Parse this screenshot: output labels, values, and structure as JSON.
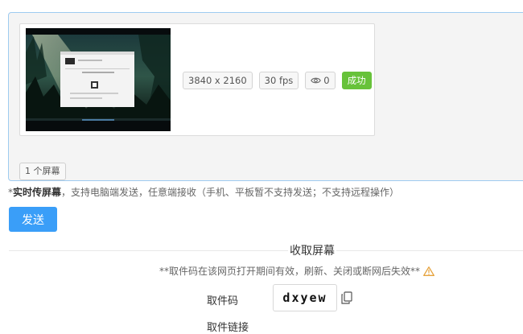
{
  "shared_screen": {
    "resolution": "3840 x 2160",
    "fps": "30 fps",
    "viewers": "0",
    "status": "成功"
  },
  "screen_count": "1 个屏幕",
  "share_note": {
    "highlight": "实时传屏幕",
    "text": "，支持电脑端发送，任意端接收（手机、平板暂不支持发送；不支持远程操作）"
  },
  "send_button": "发送",
  "receive": {
    "title": "收取屏幕",
    "note": "**取件码在该网页打开期间有效，刷新、关闭或断网后失效**",
    "code_label": "取件码",
    "code": "dxyew",
    "link_label": "取件链接"
  },
  "icons": {
    "viewers": "eye-icon",
    "warning": "warning-icon",
    "copy": "copy-icon"
  },
  "colors": {
    "primary": "#3a9ef8",
    "success": "#67c23a",
    "warning": "#e6a23c",
    "panel_border": "#9ecbf0"
  }
}
